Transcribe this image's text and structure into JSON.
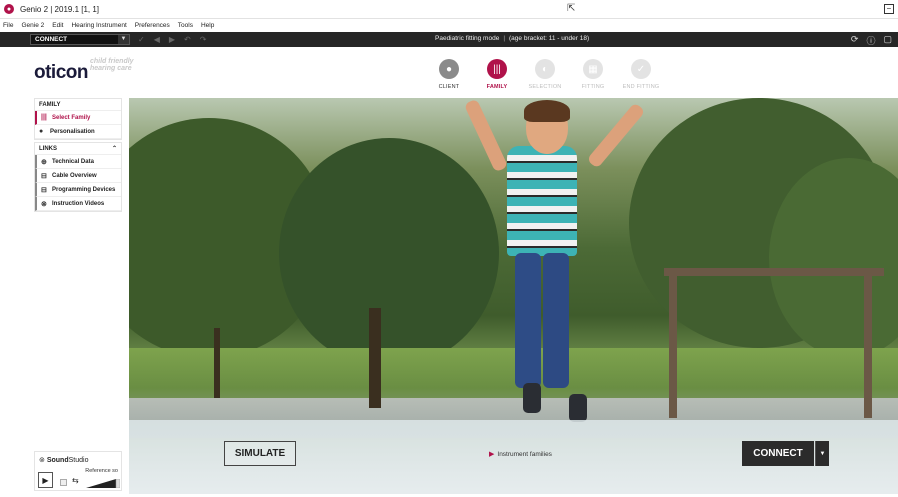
{
  "window": {
    "title": "Genio 2 | 2019.1 [1, 1]",
    "minimize_glyph": "–"
  },
  "menu": [
    "File",
    "Genie 2",
    "Edit",
    "Hearing Instrument",
    "Preferences",
    "Tools",
    "Help"
  ],
  "toolbar": {
    "connect_label": "CONNECT",
    "mode_text": "Paediatric fitting mode",
    "age_bracket": "(age bracket: 11 - under 18)"
  },
  "brand": {
    "logo": "oticon",
    "tagline": "child friendly hearing care",
    "accent_color": "#b0124a"
  },
  "steps": [
    {
      "label": "CLIENT",
      "state": "done",
      "icon": "person-icon"
    },
    {
      "label": "FAMILY",
      "state": "active",
      "icon": "family-icon"
    },
    {
      "label": "SELECTION",
      "state": "future",
      "icon": "selection-icon"
    },
    {
      "label": "FITTING",
      "state": "future",
      "icon": "fitting-icon"
    },
    {
      "label": "END FITTING",
      "state": "future",
      "icon": "check-icon"
    }
  ],
  "sidebar": {
    "family_header": "FAMILY",
    "family_items": [
      {
        "label": "Select Family",
        "icon": "family-icon",
        "selected": true
      },
      {
        "label": "Personalisation",
        "icon": "person-icon",
        "selected": false
      }
    ],
    "links_header": "LINKS",
    "link_items": [
      {
        "label": "Technical Data",
        "icon": "globe-icon"
      },
      {
        "label": "Cable Overview",
        "icon": "cable-icon"
      },
      {
        "label": "Programming Devices",
        "icon": "device-icon"
      },
      {
        "label": "Instruction Videos",
        "icon": "video-icon"
      }
    ]
  },
  "sound_studio": {
    "brand_bold": "Sound",
    "brand_rest": "Studio",
    "reference_label": "Reference so"
  },
  "hero": {
    "simulate_label": "SIMULATE",
    "instrument_link": "Instrument families",
    "connect_label": "CONNECT"
  }
}
